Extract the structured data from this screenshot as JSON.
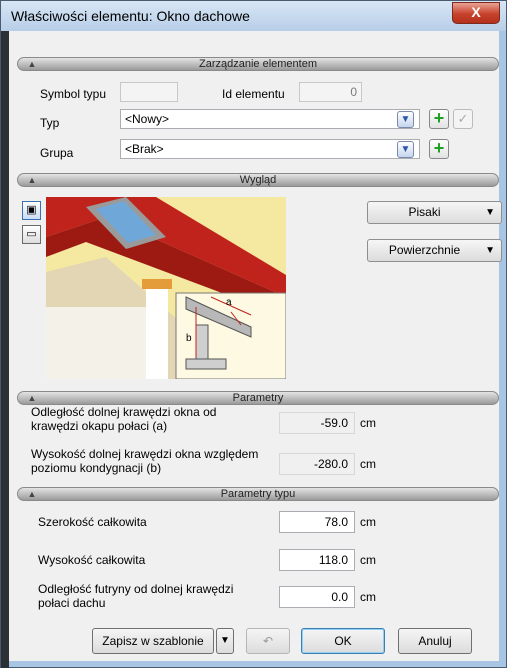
{
  "window": {
    "title": "Właściwości elementu: Okno dachowe",
    "close_label": "X"
  },
  "sections": {
    "management": "Zarządzanie elementem",
    "appearance": "Wygląd",
    "parameters": "Parametry",
    "type_parameters": "Parametry typu"
  },
  "management": {
    "symbol_label": "Symbol typu",
    "symbol_value": "",
    "id_label": "Id elementu",
    "id_value": "0",
    "type_label": "Typ",
    "type_value": "<Nowy>",
    "group_label": "Grupa",
    "group_value": "<Brak>"
  },
  "appearance": {
    "pens_button": "Pisaki",
    "surfaces_button": "Powierzchnie",
    "dim_a": "a",
    "dim_b": "b"
  },
  "parameters": {
    "rows": [
      {
        "label": "Odległość dolnej krawędzi okna od krawędzi okapu połaci (a)",
        "value": "-59.0",
        "unit": "cm"
      },
      {
        "label": "Wysokość dolnej krawędzi okna względem poziomu kondygnacji (b)",
        "value": "-280.0",
        "unit": "cm"
      }
    ]
  },
  "type_parameters": {
    "rows": [
      {
        "label": "Szerokość całkowita",
        "value": "78.0",
        "unit": "cm"
      },
      {
        "label": "Wysokość całkowita",
        "value": "118.0",
        "unit": "cm"
      },
      {
        "label": "Odległość futryny od dolnej krawędzi połaci dachu",
        "value": "0.0",
        "unit": "cm"
      }
    ]
  },
  "footer": {
    "save_template": "Zapisz w szablonie",
    "ok": "OK",
    "cancel": "Anuluj"
  },
  "colors": {
    "title_bar": "#b7cee8",
    "close_button": "#c7422c",
    "plus_icon": "#21a121",
    "roof_tiles": "#c0231b",
    "wall_yellow": "#f5e8a1"
  },
  "icons": [
    "close-icon",
    "chevron-up-icon",
    "library-icon",
    "plus-icon",
    "check-icon",
    "camera-icon",
    "cube-icon",
    "dropdown-arrow-icon",
    "undo-icon"
  ]
}
